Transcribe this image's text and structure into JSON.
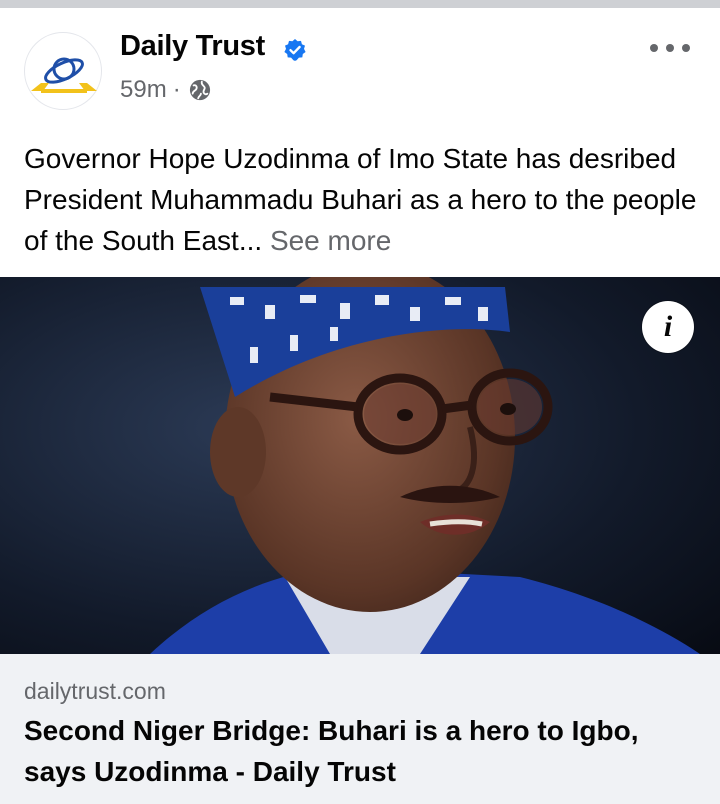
{
  "post": {
    "page_name": "Daily Trust",
    "time": "59m",
    "separator": "·",
    "text": "Governor Hope Uzodinma of Imo State has desribed President Muhammadu Buhari as a hero to the people of the South East...",
    "see_more": "See more"
  },
  "photo": {
    "info_glyph": "i"
  },
  "link_preview": {
    "domain": "dailytrust.com",
    "title": "Second Niger Bridge: Buhari is a hero to Igbo, says Uzodinma - Daily Trust"
  },
  "icons": {
    "verified": "verified-badge-icon",
    "privacy": "globe-icon",
    "more": "more-options-icon",
    "info": "info-icon"
  },
  "colors": {
    "verified_blue": "#1877f2",
    "secondary_text": "#65676b",
    "card_bg": "#f0f2f5"
  }
}
